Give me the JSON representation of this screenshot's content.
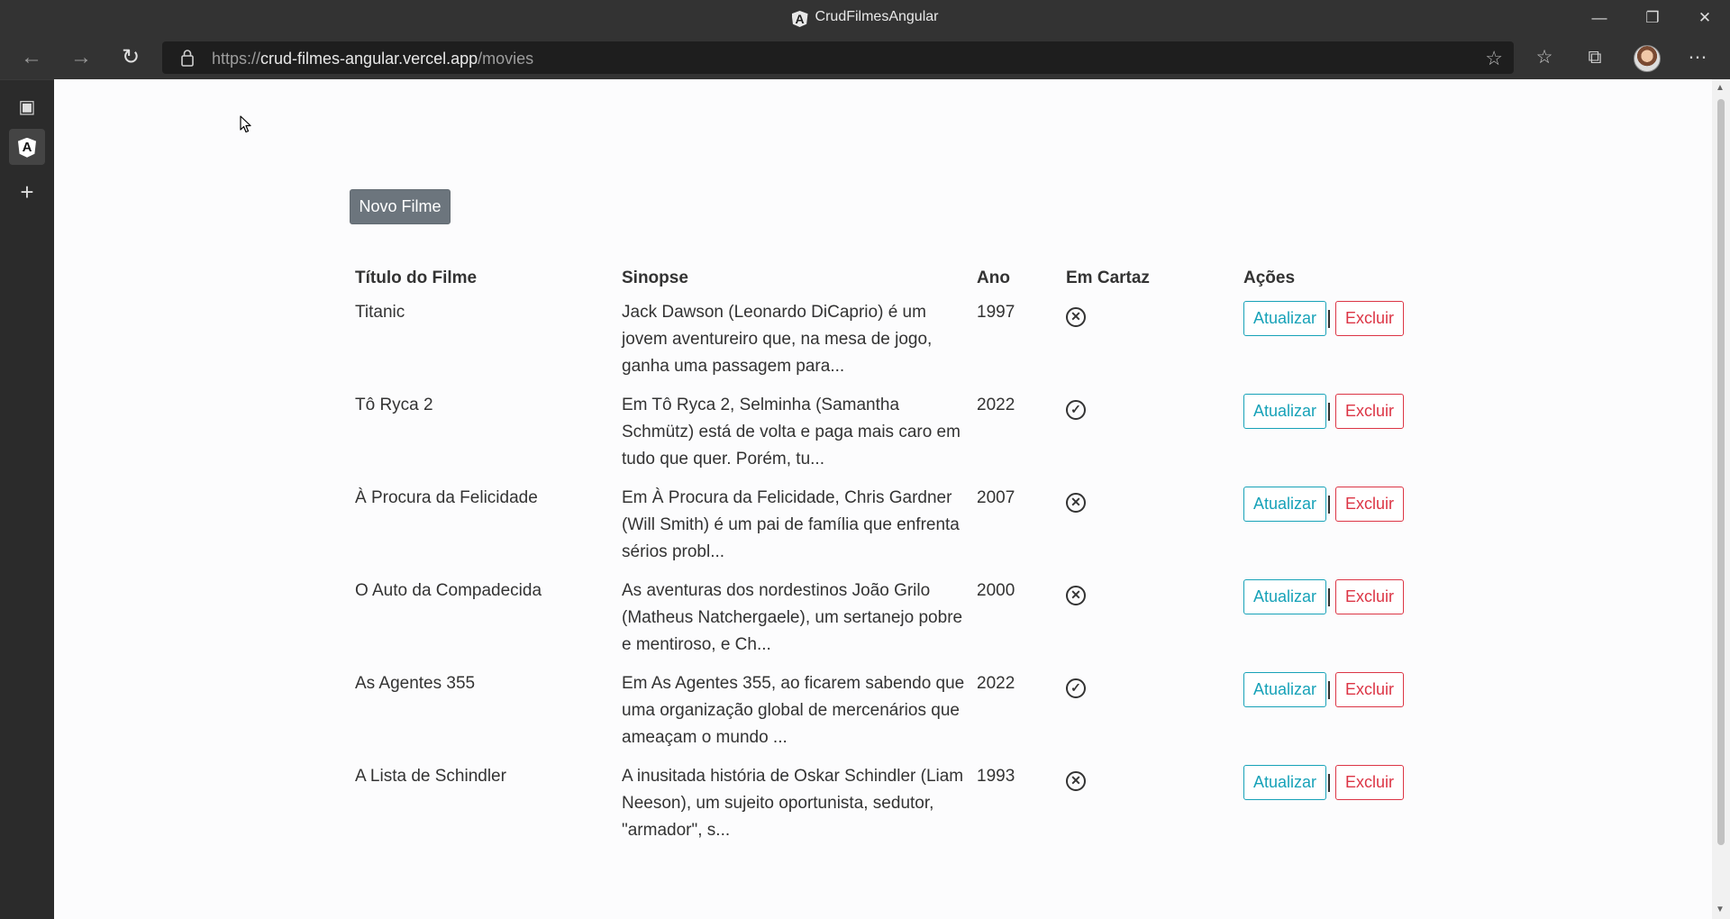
{
  "window": {
    "title": "CrudFilmesAngular",
    "app_icon": "A"
  },
  "controls": {
    "minimize": "—",
    "maximize": "❐",
    "close": "✕"
  },
  "toolbar": {
    "back": "←",
    "forward": "→",
    "refresh": "↻",
    "url_scheme": "https://",
    "url_host": "crud-filmes-angular.vercel.app",
    "url_path": "/movies",
    "favorite": "☆",
    "favorites_list": "☆",
    "collections": "⧉",
    "more": "⋯"
  },
  "rail": {
    "tabs_icon": "▣",
    "active_tab_logo": "A",
    "new_tab": "+"
  },
  "page": {
    "new_button_label": "Novo Filme",
    "headers": {
      "title": "Título do Filme",
      "synopsis": "Sinopse",
      "year": "Ano",
      "showing": "Em Cartaz",
      "actions": "Ações"
    },
    "update_label": "Atualizar",
    "delete_label": "Excluir",
    "movies": [
      {
        "title": "Titanic",
        "synopsis": "Jack Dawson (Leonardo DiCaprio) é um jovem aventureiro que, na mesa de jogo, ganha uma passagem para...",
        "year": "1997",
        "showing": false
      },
      {
        "title": "Tô Ryca 2",
        "synopsis": "Em Tô Ryca 2, Selminha (Samantha Schmütz) está de volta e paga mais caro em tudo que quer. Porém, tu...",
        "year": "2022",
        "showing": true
      },
      {
        "title": "À Procura da Felicidade",
        "synopsis": "Em À Procura da Felicidade, Chris Gardner (Will Smith) é um pai de família que enfrenta sérios probl...",
        "year": "2007",
        "showing": false
      },
      {
        "title": "O Auto da Compadecida",
        "synopsis": "As aventuras dos nordestinos João Grilo (Matheus Natchergaele), um sertanejo pobre e mentiroso, e Ch...",
        "year": "2000",
        "showing": false
      },
      {
        "title": "As Agentes 355",
        "synopsis": "Em As Agentes 355, ao ficarem sabendo que uma organização global de mercenários que ameaçam o mundo ...",
        "year": "2022",
        "showing": true
      },
      {
        "title": "A Lista de Schindler",
        "synopsis": "A inusitada história de Oskar Schindler (Liam Neeson), um sujeito oportunista, sedutor, \"armador\", s...",
        "year": "1993",
        "showing": false
      }
    ]
  },
  "icons": {
    "showing_true": "✓",
    "showing_false": "✕"
  },
  "colors": {
    "update": "#17a2b8",
    "delete": "#dc3545",
    "new_button": "#6c757d"
  }
}
